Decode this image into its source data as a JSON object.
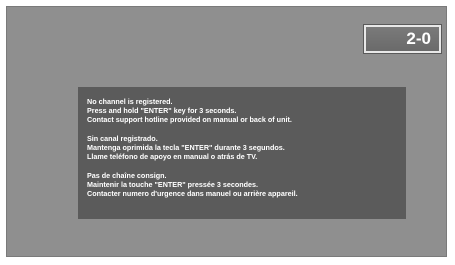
{
  "channel_display": "2-0",
  "message": {
    "english": [
      "No channel is registered.",
      "Press and hold \"ENTER\" key for 3 seconds.",
      "Contact support hotline provided on manual or back of unit."
    ],
    "spanish": [
      "Sin canal registrado.",
      "Mantenga oprimida la tecla \"ENTER\" durante 3 segundos.",
      "Llame teléfono de apoyo en manual o atrás de TV."
    ],
    "french": [
      "Pas de chaîne consign.",
      "Maintenir la touche \"ENTER\" pressée 3 secondes.",
      "Contacter numero d'urgence dans manuel ou arrière appareil."
    ]
  },
  "colors": {
    "screen_background": "#8f8f8f",
    "panel_background": "#5b5b5b",
    "text": "#ffffff"
  }
}
